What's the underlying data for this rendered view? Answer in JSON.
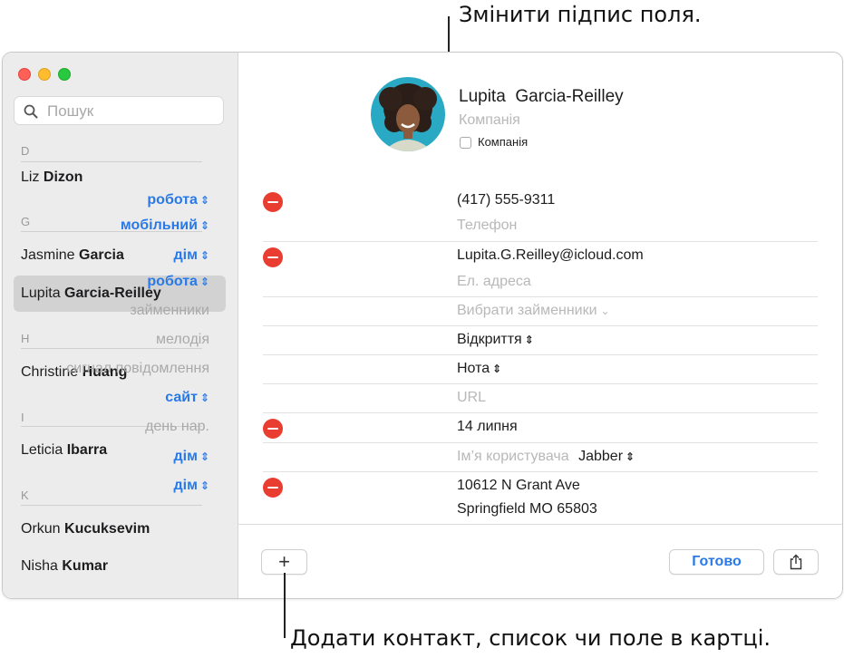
{
  "callouts": {
    "top": "Змінити підпис поля.",
    "bottom": "Додати контакт, список чи поле в картці."
  },
  "sidebar": {
    "search_placeholder": "Пошук",
    "sections": [
      {
        "letter": "D",
        "contacts": [
          {
            "first": "Liz",
            "last": "Dizon",
            "selected": false
          }
        ]
      },
      {
        "letter": "G",
        "contacts": [
          {
            "first": "Jasmine",
            "last": "Garcia",
            "selected": false
          },
          {
            "first": "Lupita",
            "last": "Garcia-Reilley",
            "selected": true
          }
        ]
      },
      {
        "letter": "H",
        "contacts": [
          {
            "first": "Christine",
            "last": "Huang",
            "selected": false
          }
        ]
      },
      {
        "letter": "I",
        "contacts": [
          {
            "first": "Leticia",
            "last": "Ibarra",
            "selected": false
          }
        ]
      },
      {
        "letter": "K",
        "contacts": [
          {
            "first": "Orkun",
            "last": "Kucuksevim",
            "selected": false
          },
          {
            "first": "Nisha",
            "last": "Kumar",
            "selected": false
          }
        ]
      }
    ]
  },
  "card": {
    "first_name": "Lupita",
    "last_name": "Garcia-Reilley",
    "company_placeholder": "Компанія",
    "company_checkbox_label": "Компанія",
    "fields": [
      {
        "label": "робота",
        "value": "(417) 555-9311"
      },
      {
        "label": "мобільний",
        "placeholder": "Телефон"
      },
      {
        "label": "дім",
        "value": "Lupita.G.Reilley@icloud.com"
      },
      {
        "label": "робота",
        "placeholder": "Ел. адреса"
      },
      {
        "label": "займенники",
        "placeholder": "Вибрати займенники"
      },
      {
        "label": "мелодія",
        "value": "Відкриття"
      },
      {
        "label": "сигнал повідомлення",
        "value": "Нота"
      },
      {
        "label": "сайт",
        "placeholder": "URL"
      },
      {
        "label": "день нар.",
        "value": "14 липня"
      },
      {
        "label": "дім",
        "placeholder": "Ім’я користувача",
        "service": "Jabber"
      },
      {
        "label": "дім",
        "address_line1": "10612 N Grant Ave",
        "address_line2": "Springfield MO 65803"
      }
    ]
  },
  "footer": {
    "add_label": "+",
    "done_label": "Готово"
  },
  "colors": {
    "accent": "#2979e8",
    "delete": "#ea3d31",
    "selection": "#d2d2d2",
    "sidebar_bg": "#ececec"
  }
}
